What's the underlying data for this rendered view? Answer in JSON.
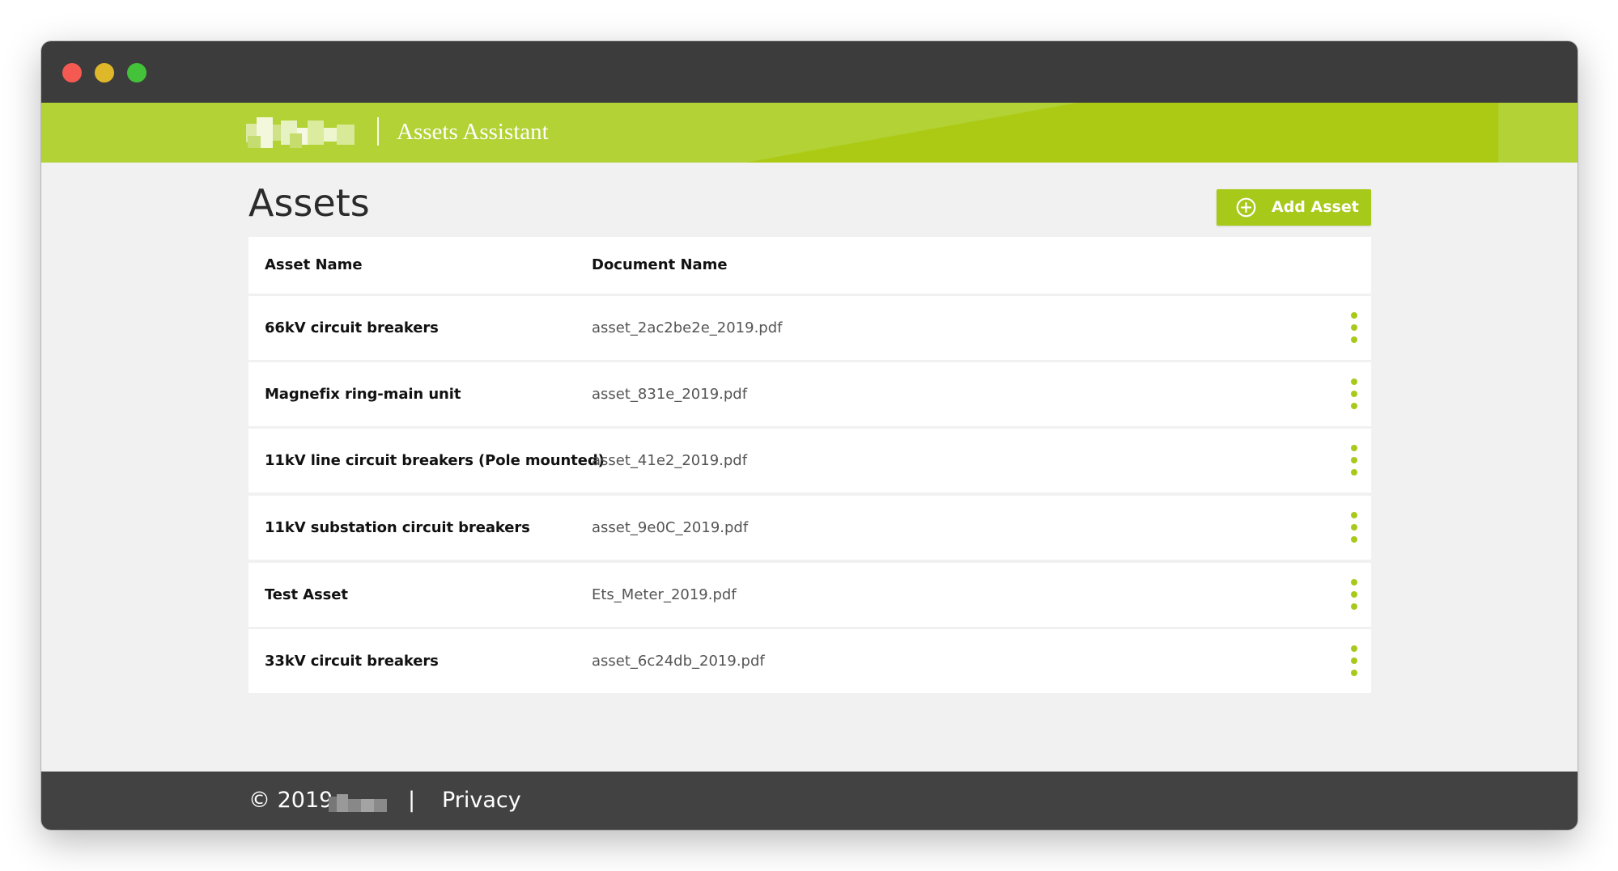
{
  "window": {
    "controls": [
      "close",
      "minimize",
      "maximize"
    ]
  },
  "header": {
    "app_title": "Assets Assistant",
    "logo_icon": "brand-logo-icon",
    "colors": {
      "primary": "#b2d235",
      "accent_dark": "#a7c919"
    }
  },
  "page": {
    "title": "Assets",
    "add_button_label": "Add Asset",
    "add_button_icon": "plus-circle-icon"
  },
  "table": {
    "columns": [
      "Asset Name",
      "Document Name"
    ],
    "rows": [
      {
        "asset_name": "66kV circuit breakers",
        "document_name": "asset_2ac2be2e_2019.pdf"
      },
      {
        "asset_name": "Magnefix ring-main unit",
        "document_name": "asset_831e_2019.pdf"
      },
      {
        "asset_name": "11kV line circuit breakers (Pole mounted)",
        "document_name": "asset_41e2_2019.pdf"
      },
      {
        "asset_name": "11kV substation circuit breakers",
        "document_name": "asset_9e0C_2019.pdf"
      },
      {
        "asset_name": "Test Asset",
        "document_name": "Ets_Meter_2019.pdf"
      },
      {
        "asset_name": "33kV circuit breakers",
        "document_name": "asset_6c24db_2019.pdf"
      }
    ],
    "row_action_icon": "more-vertical-icon"
  },
  "footer": {
    "copyright": "© 2019",
    "divider": "|",
    "privacy_label": "Privacy"
  }
}
